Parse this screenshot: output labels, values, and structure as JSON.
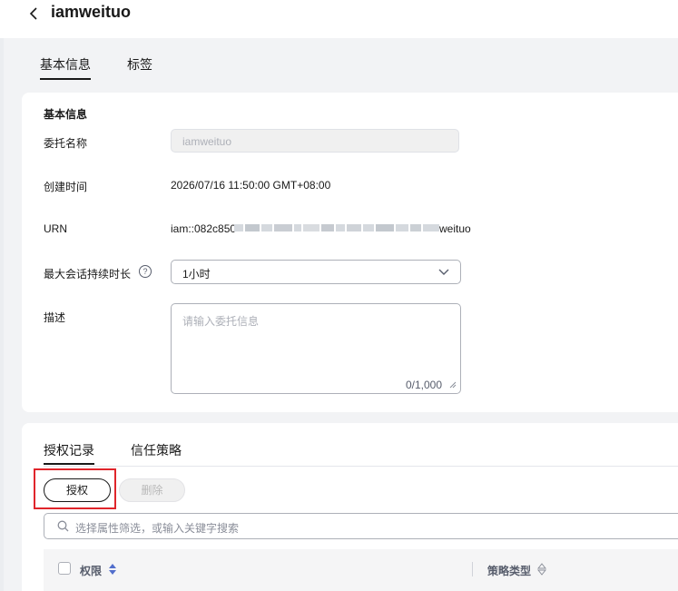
{
  "header": {
    "title": "iamweituo"
  },
  "tabs": [
    {
      "label": "基本信息"
    },
    {
      "label": "标签"
    }
  ],
  "basic_info": {
    "section_title": "基本信息",
    "name_label": "委托名称",
    "name_value": "iamweituo",
    "created_label": "创建时间",
    "created_value": "2026/07/16 11:50:00 GMT+08:00",
    "urn_label": "URN",
    "urn_prefix": "iam::082c850",
    "urn_suffix": "weituo",
    "duration_label": "最大会话持续时长",
    "duration_help": "?",
    "duration_value": "1小时",
    "desc_label": "描述",
    "desc_placeholder": "请输入委托信息",
    "desc_count": "0/1,000"
  },
  "records": {
    "tabs": [
      {
        "label": "授权记录"
      },
      {
        "label": "信任策略"
      }
    ],
    "grant_button": "授权",
    "delete_button": "删除",
    "search_placeholder": "选择属性筛选，或输入关键字搜索",
    "columns": [
      {
        "label": "权限"
      },
      {
        "label": "策略类型"
      }
    ]
  },
  "colors": {
    "highlight": "#e0252b",
    "sort_active": "#526ecc"
  }
}
